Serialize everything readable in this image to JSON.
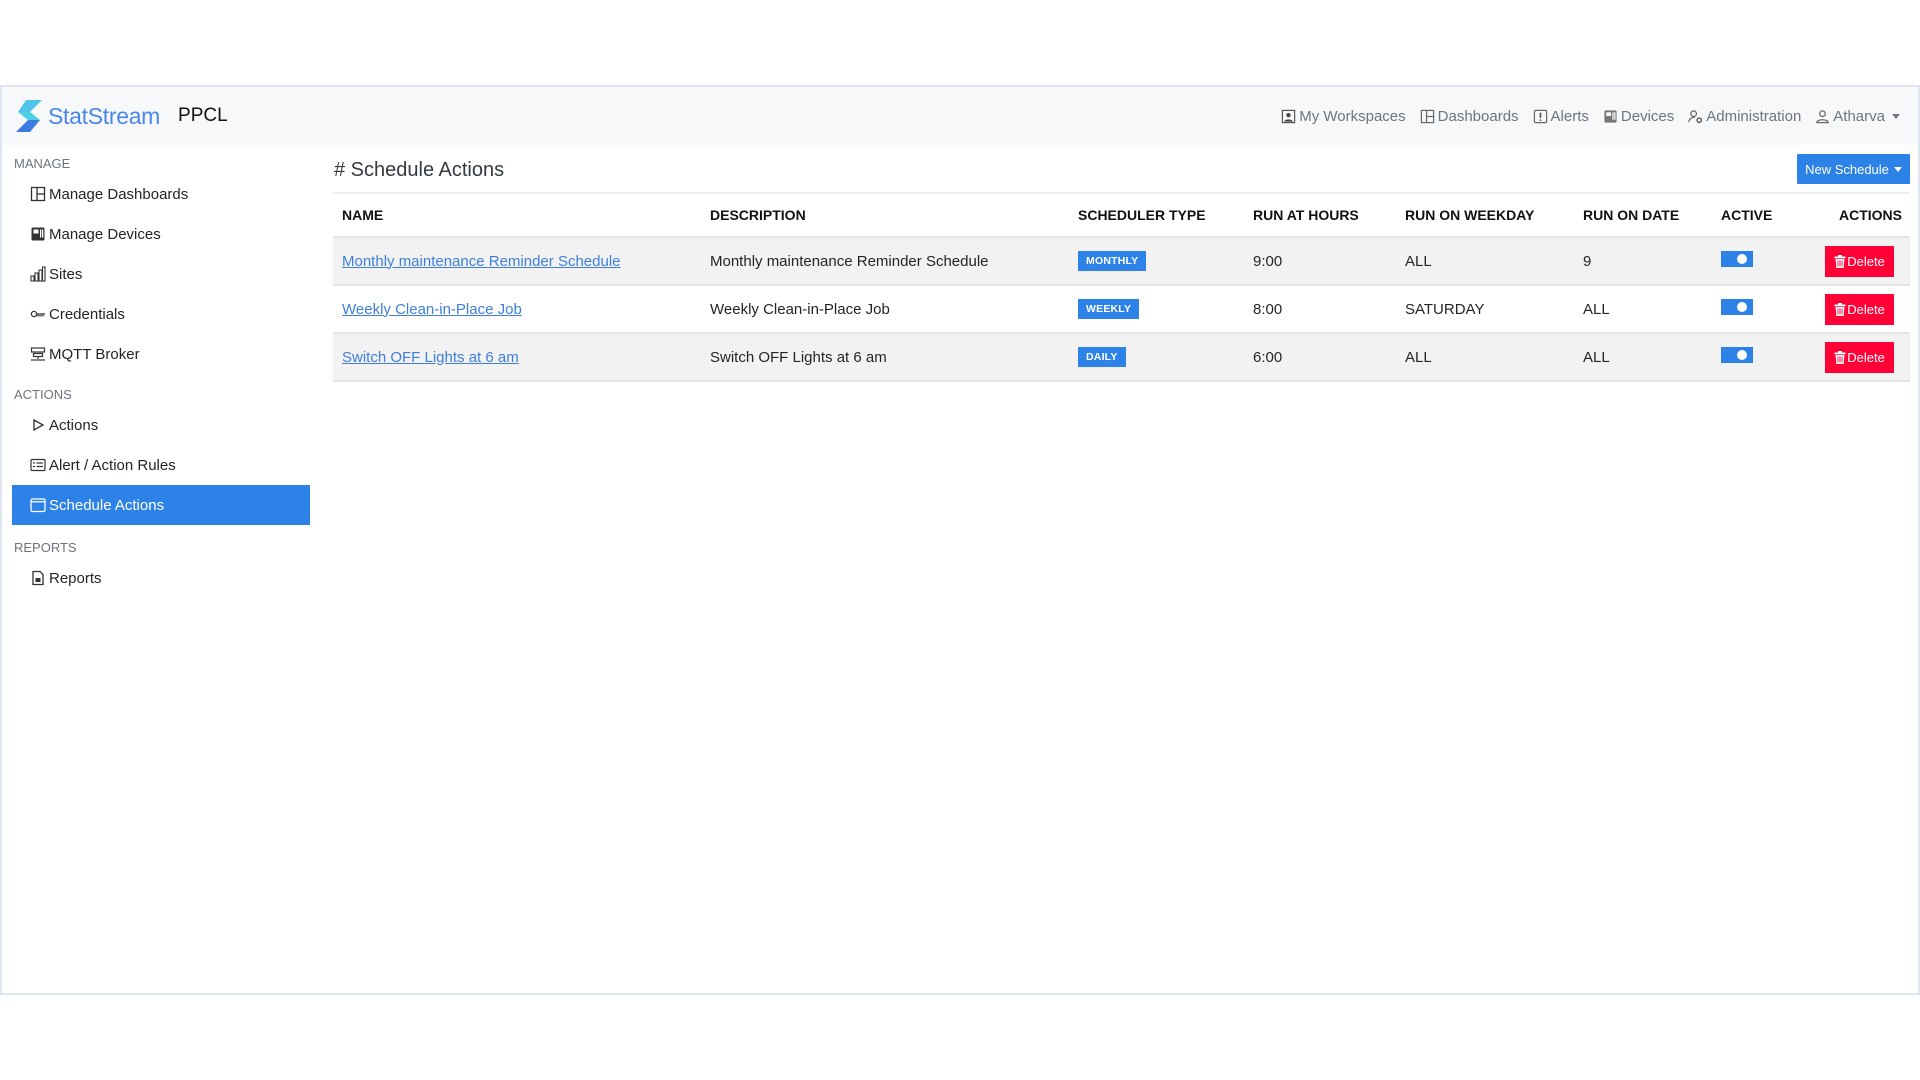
{
  "header": {
    "brand_name": "StatStream",
    "org_name": "PPCL",
    "nav": [
      {
        "label": "My Workspaces",
        "icon": "workspace-icon"
      },
      {
        "label": "Dashboards",
        "icon": "dashboard-icon"
      },
      {
        "label": "Alerts",
        "icon": "alert-icon"
      },
      {
        "label": "Devices",
        "icon": "device-icon"
      },
      {
        "label": "Administration",
        "icon": "admin-icon"
      }
    ],
    "user": {
      "label": "Atharva",
      "icon": "user-icon"
    }
  },
  "sidebar": {
    "sections": [
      {
        "heading": "MANAGE",
        "items": [
          {
            "label": "Manage Dashboards",
            "icon": "dashboard-icon"
          },
          {
            "label": "Manage Devices",
            "icon": "device-icon"
          },
          {
            "label": "Sites",
            "icon": "sites-icon"
          },
          {
            "label": "Credentials",
            "icon": "key-icon"
          },
          {
            "label": "MQTT Broker",
            "icon": "broker-icon"
          }
        ]
      },
      {
        "heading": "ACTIONS",
        "items": [
          {
            "label": "Actions",
            "icon": "play-icon"
          },
          {
            "label": "Alert / Action Rules",
            "icon": "rules-icon"
          },
          {
            "label": "Schedule Actions",
            "icon": "calendar-icon",
            "active": true
          }
        ]
      },
      {
        "heading": "REPORTS",
        "items": [
          {
            "label": "Reports",
            "icon": "report-icon"
          }
        ]
      }
    ]
  },
  "main": {
    "title": "# Schedule Actions",
    "new_button_label": "New Schedule",
    "table": {
      "columns": [
        "NAME",
        "DESCRIPTION",
        "SCHEDULER TYPE",
        "RUN AT HOURS",
        "RUN ON WEEKDAY",
        "RUN ON DATE",
        "ACTIVE",
        "ACTIONS"
      ],
      "rows": [
        {
          "name": "Monthly maintenance Reminder Schedule",
          "description": "Monthly maintenance Reminder Schedule",
          "type": "MONTHLY",
          "hours": "9:00",
          "weekday": "ALL",
          "date": "9",
          "active": true,
          "action_label": "Delete"
        },
        {
          "name": "Weekly Clean-in-Place Job",
          "description": "Weekly Clean-in-Place Job",
          "type": "WEEKLY",
          "hours": "8:00",
          "weekday": "SATURDAY",
          "date": "ALL",
          "active": true,
          "action_label": "Delete"
        },
        {
          "name": "Switch OFF Lights at 6 am",
          "description": "Switch OFF Lights at 6 am",
          "type": "DAILY",
          "hours": "6:00",
          "weekday": "ALL",
          "date": "ALL",
          "active": true,
          "action_label": "Delete"
        }
      ]
    }
  },
  "colors": {
    "accent": "#2c82e6",
    "danger": "#ff0037",
    "link": "#3f7fd8",
    "brand": "#4a86e8"
  }
}
